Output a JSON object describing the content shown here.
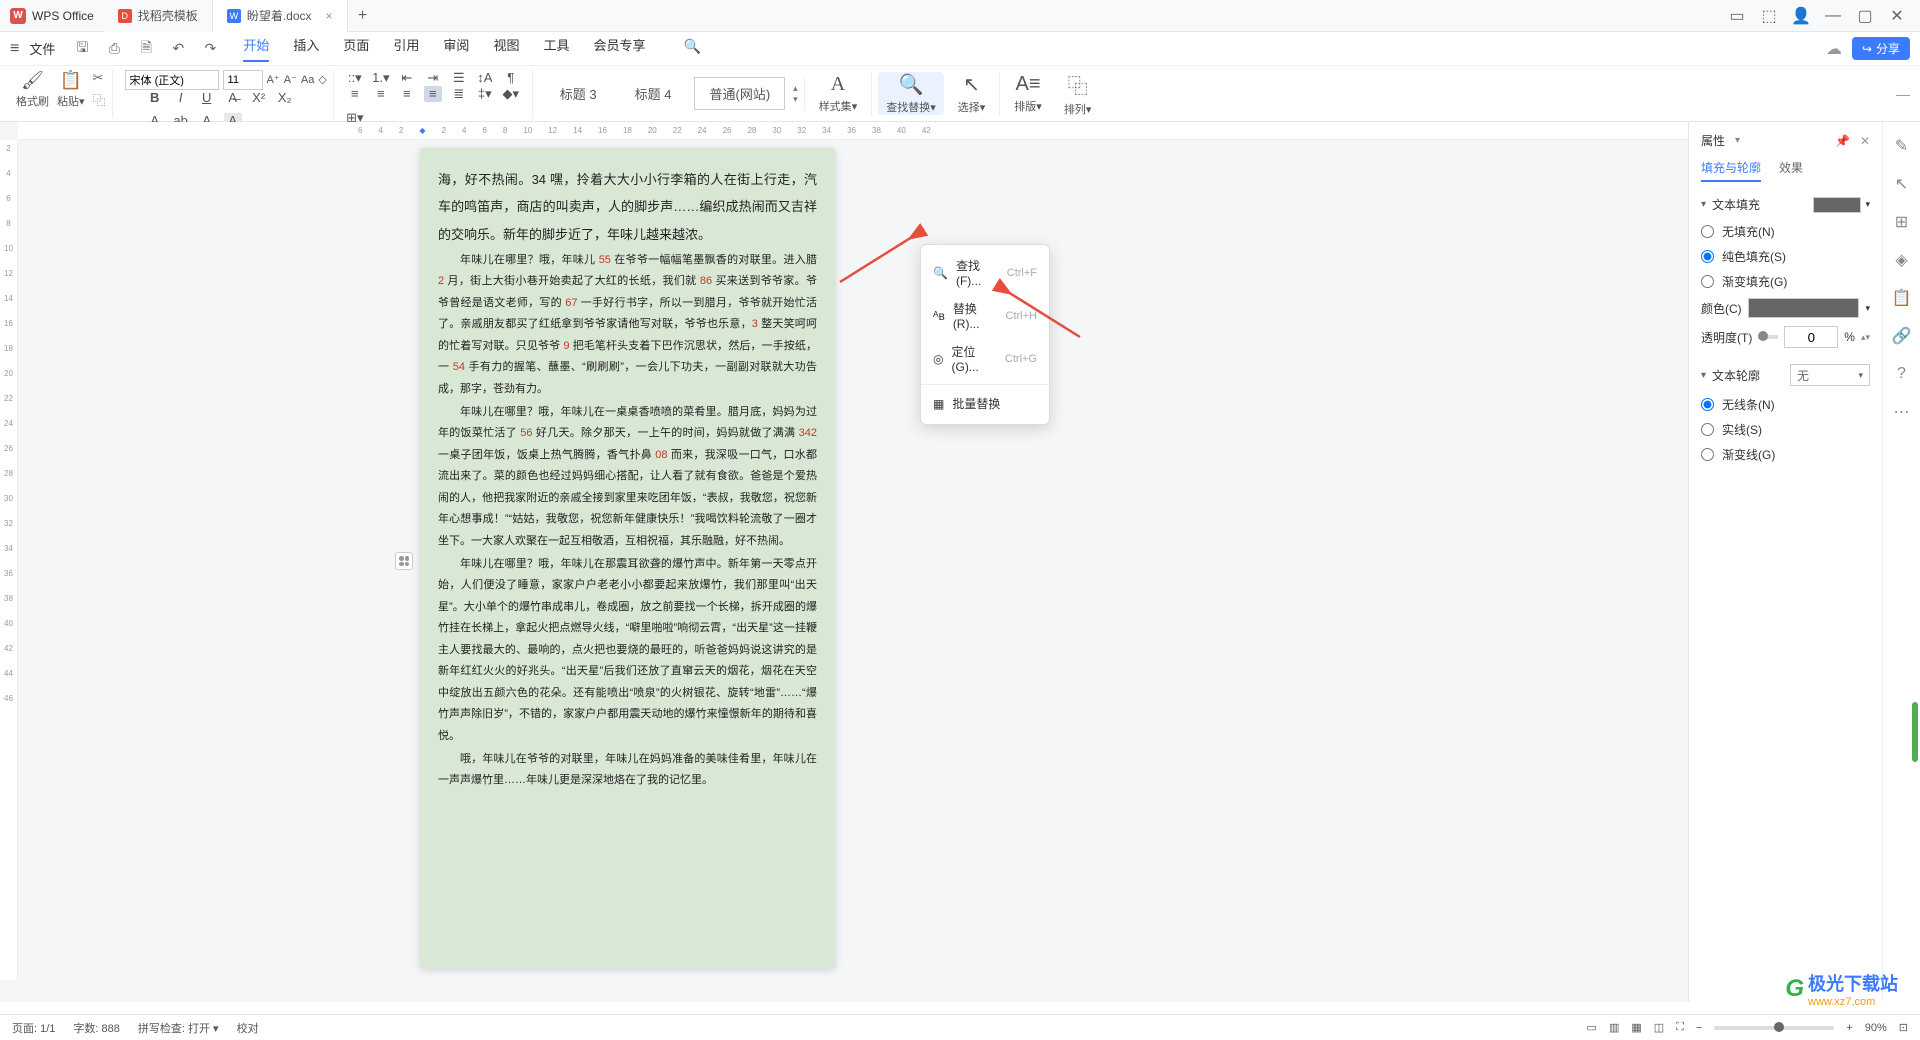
{
  "titlebar": {
    "app_name": "WPS Office",
    "tabs": [
      {
        "label": "找稻壳模板",
        "icon_bg": "#e74c3c",
        "icon_text": "D"
      },
      {
        "label": "盼望着.docx",
        "icon_bg": "#3b7cff",
        "icon_text": "W",
        "active": true
      }
    ]
  },
  "menubar": {
    "file_label": "文件",
    "items": [
      "开始",
      "插入",
      "页面",
      "引用",
      "审阅",
      "视图",
      "工具",
      "会员专享"
    ],
    "active": "开始",
    "share_label": "分享"
  },
  "ribbon": {
    "brush": "格式刷",
    "paste": "粘贴",
    "font_name": "宋体 (正文)",
    "font_size": "11",
    "headings": [
      "标题 3",
      "标题 4",
      "普通(网站)"
    ],
    "style_gallery": "样式集",
    "find_replace": "查找替换",
    "select": "选择",
    "layout": "排版",
    "arrange": "排列"
  },
  "hruler_marks": [
    "6",
    "4",
    "2",
    "2",
    "4",
    "6",
    "8",
    "10",
    "12",
    "14",
    "16",
    "18",
    "20",
    "22",
    "24",
    "26",
    "28",
    "30",
    "32",
    "34",
    "36",
    "38",
    "40",
    "42"
  ],
  "vruler_marks": [
    "2",
    "4",
    "6",
    "8",
    "10",
    "12",
    "14",
    "16",
    "18",
    "20",
    "22",
    "24",
    "26",
    "28",
    "30",
    "32",
    "34",
    "36",
    "38",
    "40",
    "42",
    "44",
    "46"
  ],
  "dropdown": {
    "find": "查找(F)...",
    "find_sc": "Ctrl+F",
    "replace": "替换(R)...",
    "replace_sc": "Ctrl+H",
    "goto": "定位(G)...",
    "goto_sc": "Ctrl+G",
    "batch": "批量替换"
  },
  "document": {
    "p1": "海，好不热闹。34 嘿，拎着大大小小行李箱的人在街上行走，汽车的鸣笛声，商店的叫卖声，人的脚步声……编织成热闹而又吉祥的交响乐。新年的脚步近了，年味儿越来越浓。",
    "p2a": "年味儿在哪里？哦，年味儿",
    "p2n1": "55",
    "p2b": "在爷爷一幅幅笔墨飘香的对联里。进入腊",
    "p2n2": "2",
    "p2c": "月，街上大街小巷开始卖起了大红的长纸，我们就",
    "p2n3": "86",
    "p2d": "买来送到爷爷家。爷爷曾经是语文老师，写的",
    "p2n4": "67",
    "p2e": "一手好行书字，所以一到腊月，爷爷就开始忙活了。亲戚朋友都买了红纸拿到爷爷家请他写对联，爷爷也乐意，",
    "p2n5": "3",
    "p2f": "整天笑呵呵的忙着写对联。只见爷爷",
    "p2n6": "9",
    "p2g": "把毛笔杆头支着下巴作沉思状，然后，一手按纸，一",
    "p2n7": "54",
    "p2h": "手有力的握笔、蘸墨、“刷刷刷”，一会儿下功夫，一副副对联就大功告成，那字，苍劲有力。",
    "p3a": "年味儿在哪里？哦，年味儿在一桌桌香喷喷的菜肴里。腊月底，妈妈为过年的饭菜忙活了",
    "p3n1": "56",
    "p3b": "好几天。除夕那天，一上午的时间，妈妈就做了满满",
    "p3n2": "342",
    "p3c": "一桌子团年饭，饭桌上热气腾腾，香气扑鼻",
    "p3n3": "08",
    "p3d": "而来，我深吸一口气，口水都流出来了。菜的颜色也经过妈妈细心搭配，让人看了就有食欲。爸爸是个爱热闹的人，他把我家附近的亲戚全接到家里来吃团年饭，“表叔，我敬您，祝您新年心想事成！”“姑姑，我敬您，祝您新年健康快乐！”我喝饮料轮流敬了一圈才坐下。一大家人欢聚在一起互相敬酒，互相祝福，其乐融融，好不热闹。",
    "p4": "年味儿在哪里？哦，年味儿在那震耳欲聋的爆竹声中。新年第一天零点开始，人们便没了睡意，家家户户老老小小都要起来放爆竹，我们那里叫“出天星”。大小单个的爆竹串成串儿，卷成圈，放之前要找一个长梯，拆开成圈的爆竹挂在长梯上，拿起火把点燃导火线，“噼里啪啦”响彻云霄，“出天星”这一挂鞭主人要找最大的、最响的，点火把也要烧的最旺的，听爸爸妈妈说这讲究的是新年红红火火的好兆头。“出天星”后我们还放了直窜云天的烟花，烟花在天空中绽放出五颜六色的花朵。还有能喷出“喷泉”的火树银花、旋转“地雷”……“爆竹声声除旧岁”，不错的，家家户户都用震天动地的爆竹来憧憬新年的期待和喜悦。",
    "p5": "哦，年味儿在爷爷的对联里，年味儿在妈妈准备的美味佳肴里，年味儿在一声声爆竹里……年味儿更是深深地烙在了我的记忆里。"
  },
  "right_panel": {
    "title": "属性",
    "tab1": "填充与轮廓",
    "tab2": "效果",
    "section_fill": "文本填充",
    "opt_none": "无填充(N)",
    "opt_solid": "纯色填充(S)",
    "opt_gradient": "渐变填充(G)",
    "color_label": "颜色(C)",
    "alpha_label": "透明度(T)",
    "alpha_val": "0",
    "alpha_unit": "%",
    "section_outline": "文本轮廓",
    "outline_sel": "无",
    "opt_noline": "无线条(N)",
    "opt_solidline": "实线(S)",
    "opt_gradline": "渐变线(G)"
  },
  "statusbar": {
    "page": "页面: 1/1",
    "words": "字数: 888",
    "spell": "拼写检查: 打开",
    "proof": "校对",
    "zoom": "90%"
  },
  "watermark": {
    "brand": "极光下载站",
    "url": "www.xz7.com"
  }
}
